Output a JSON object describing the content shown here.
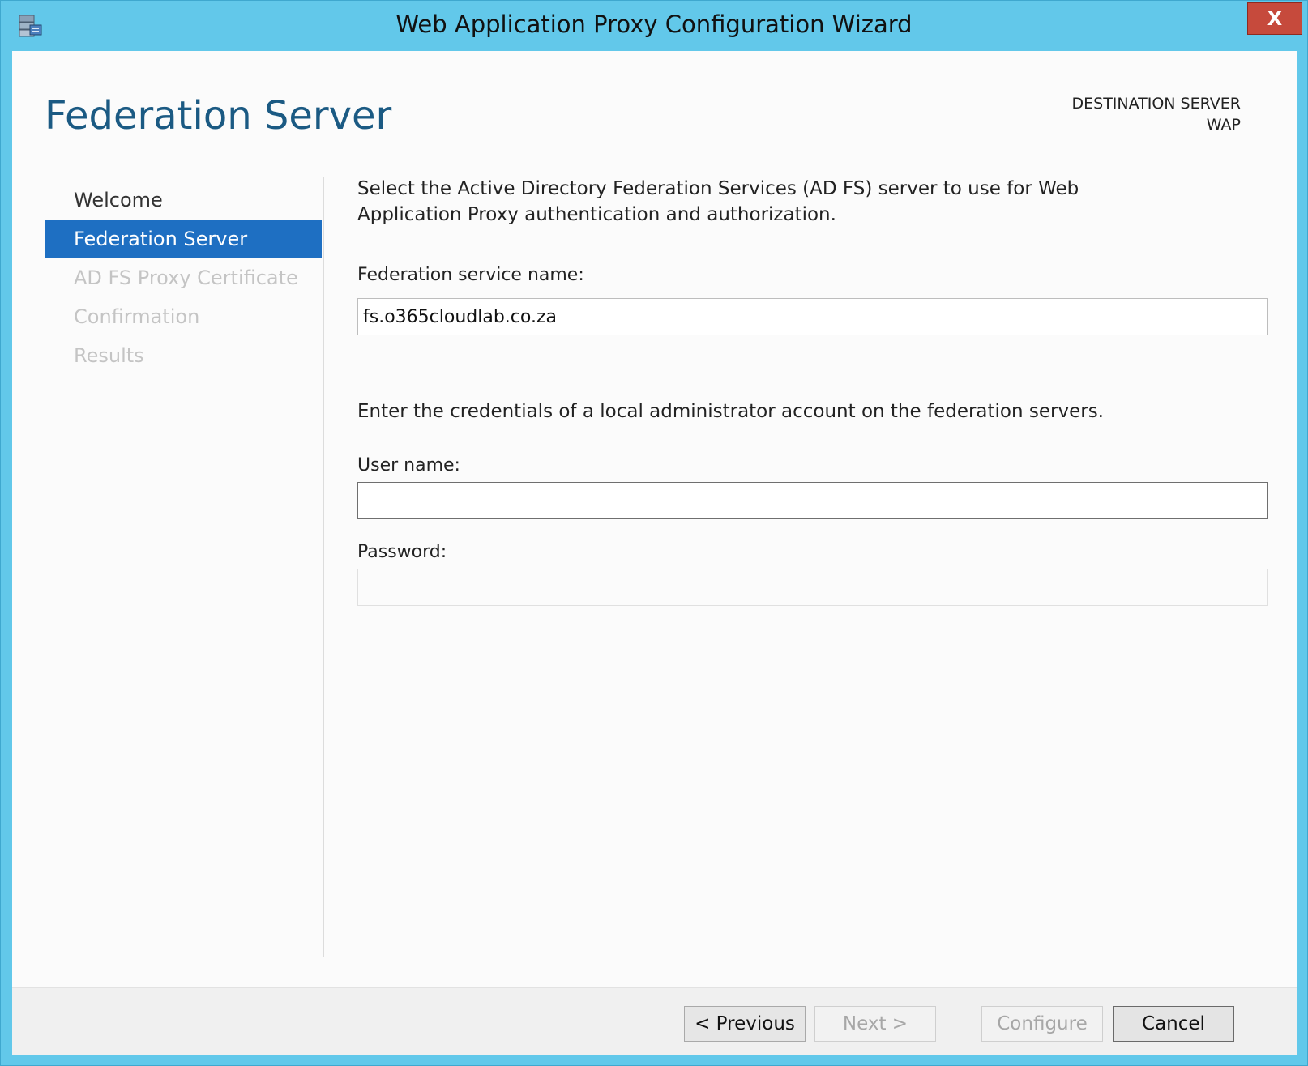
{
  "window": {
    "title": "Web Application Proxy Configuration Wizard",
    "close_label": "X",
    "app_icon": "server-manager-icon"
  },
  "header": {
    "page_title": "Federation Server",
    "destination_label": "DESTINATION SERVER",
    "destination_value": "WAP"
  },
  "nav": {
    "items": [
      {
        "label": "Welcome",
        "state": "normal"
      },
      {
        "label": "Federation Server",
        "state": "active"
      },
      {
        "label": "AD FS Proxy Certificate",
        "state": "disabled"
      },
      {
        "label": "Confirmation",
        "state": "disabled"
      },
      {
        "label": "Results",
        "state": "disabled"
      }
    ]
  },
  "main": {
    "description": "Select the Active Directory Federation Services (AD FS) server to use for Web Application Proxy authentication and authorization.",
    "federation_label": "Federation service name:",
    "federation_value": "fs.o365cloudlab.co.za",
    "credentials_text": "Enter the credentials of a local administrator account on the federation servers.",
    "username_label": "User name:",
    "username_value": "",
    "password_label": "Password:",
    "password_value": ""
  },
  "footer": {
    "previous_label": "< Previous",
    "next_label": "Next >",
    "configure_label": "Configure",
    "cancel_label": "Cancel"
  },
  "colors": {
    "frame": "#62c8ea",
    "accent": "#1e6fc2",
    "title": "#1b5a83",
    "close": "#c64a3c"
  }
}
